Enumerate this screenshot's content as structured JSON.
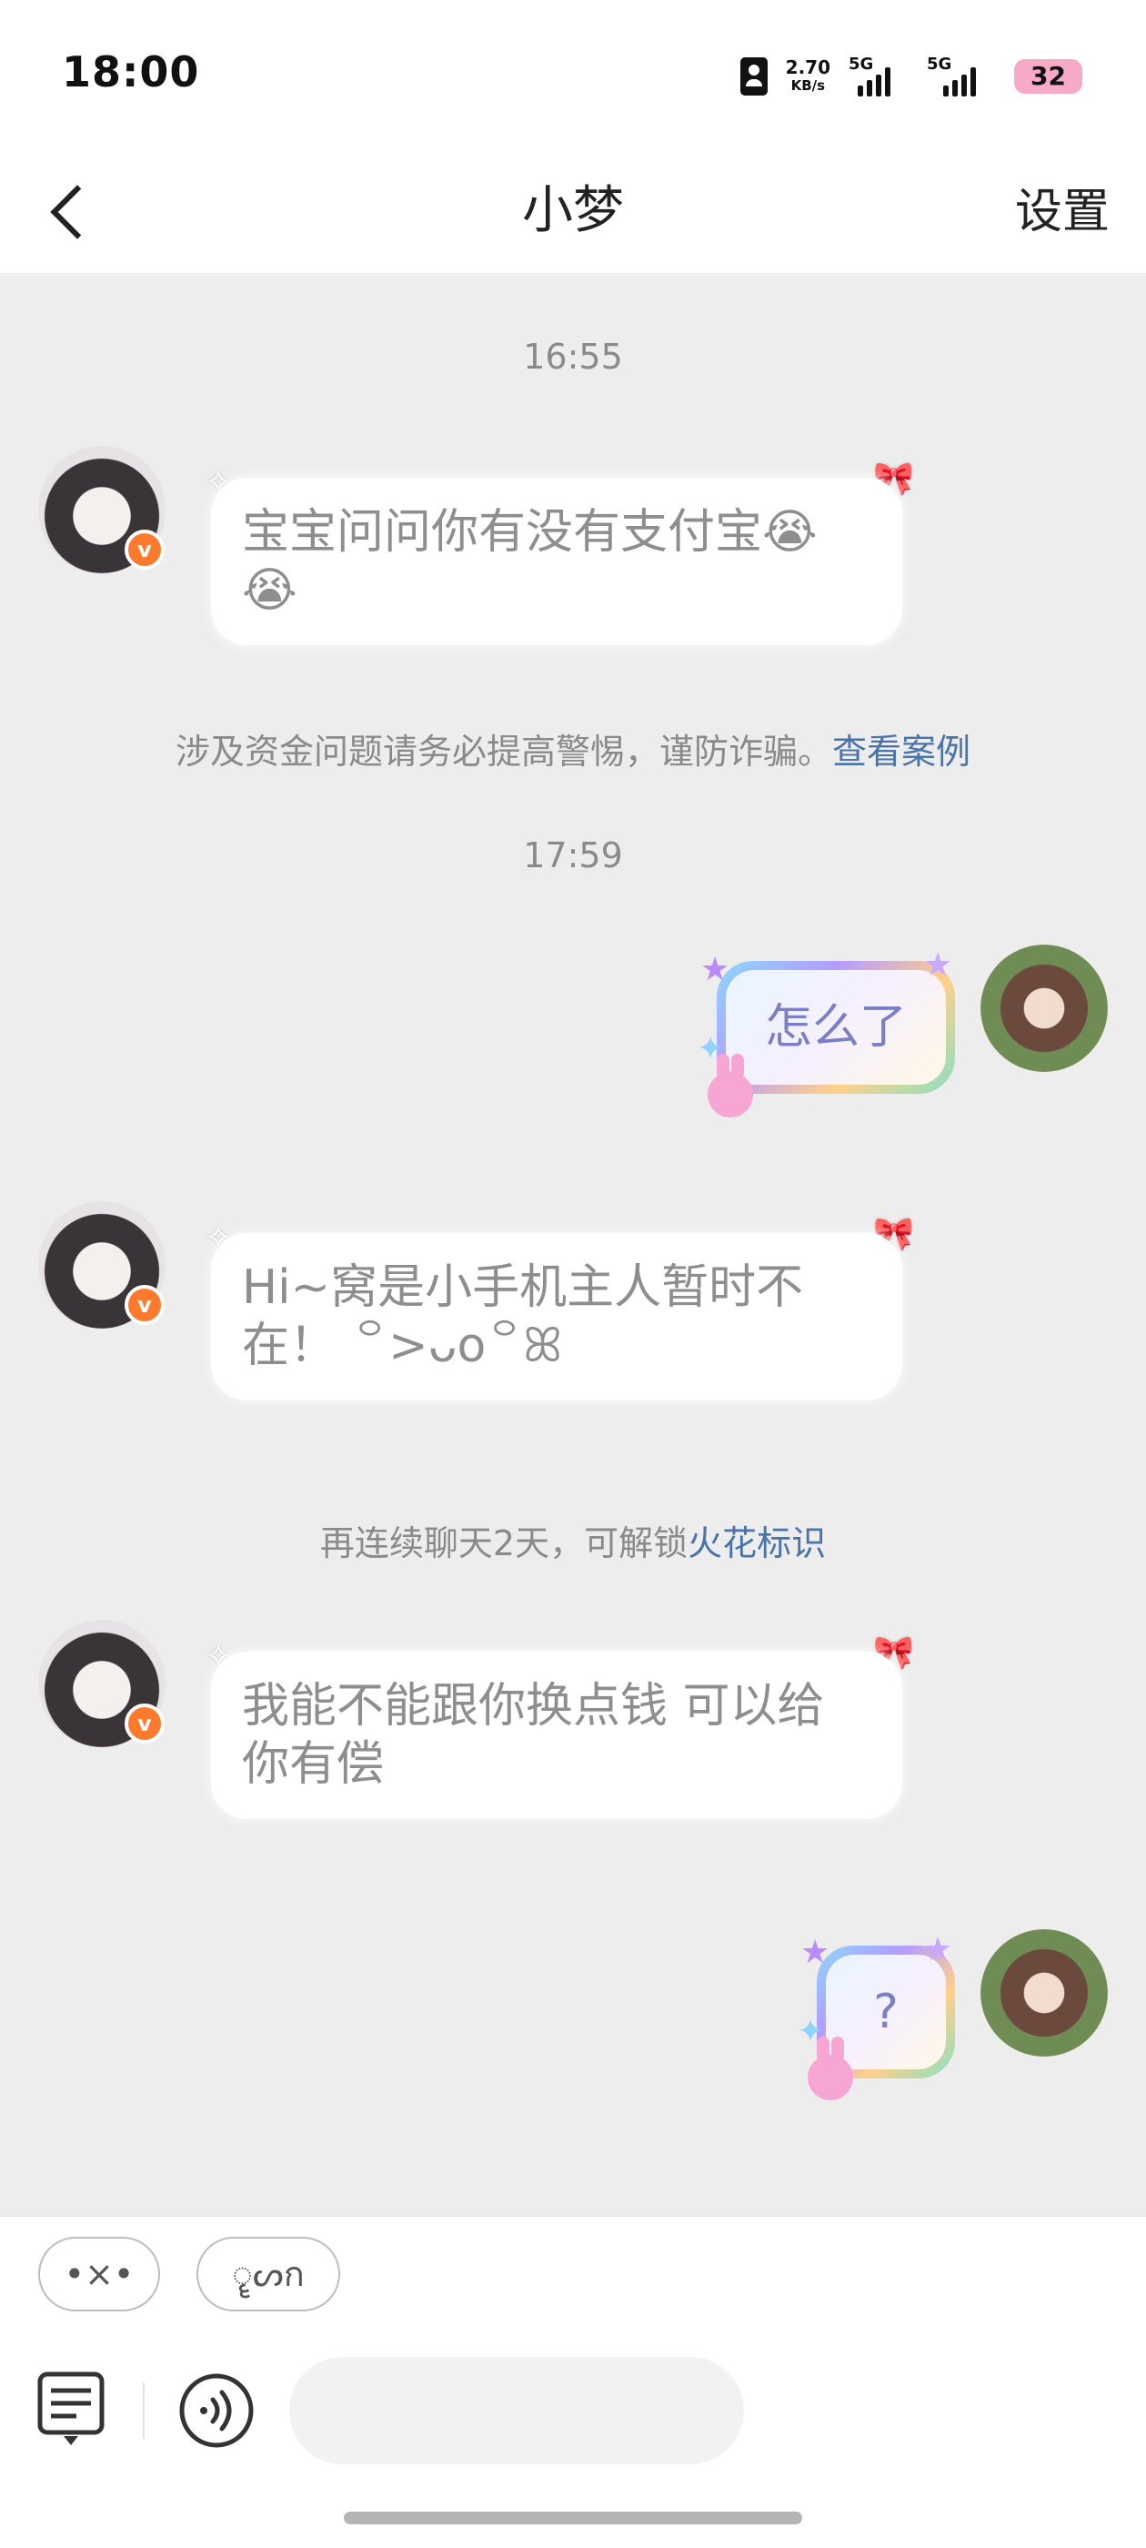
{
  "status_bar": {
    "time": "18:00",
    "net_speed_value": "2.70",
    "net_speed_unit": "KB/s",
    "signal_1_label": "5G",
    "signal_2_label": "5G",
    "battery": "32"
  },
  "nav": {
    "title": "小梦",
    "settings_label": "设置"
  },
  "chat": {
    "time_1": "16:55",
    "msg_1": "宝宝问问你有没有支付宝😭😭",
    "notice_1_text": "涉及资金问题请务必提高警惕，谨防诈骗。",
    "notice_1_link": "查看案例",
    "time_2": "17:59",
    "msg_2": "怎么了",
    "msg_3": "Hi~窝是小手机主人暂时不在！ ꒪>ᴗo꒪ꕤ",
    "notice_2_text": "再连续聊天2天，可解锁",
    "notice_2_link": "火花标识",
    "msg_4": "我能不能跟你换点钱 可以给你有偿",
    "msg_5": "?"
  },
  "quick_replies": {
    "chip_1": "•×•",
    "chip_2": "ॄᔕก"
  },
  "colors": {
    "chat_bg": "#ededed",
    "link": "#4a74a8",
    "verified_badge": "#ff7a2d",
    "battery_bg": "#f7a9c8"
  },
  "icons": {
    "back": "chevron-left-icon",
    "text_panel": "message-list-icon",
    "voice": "voice-icon",
    "verified": "verified-v-icon"
  }
}
